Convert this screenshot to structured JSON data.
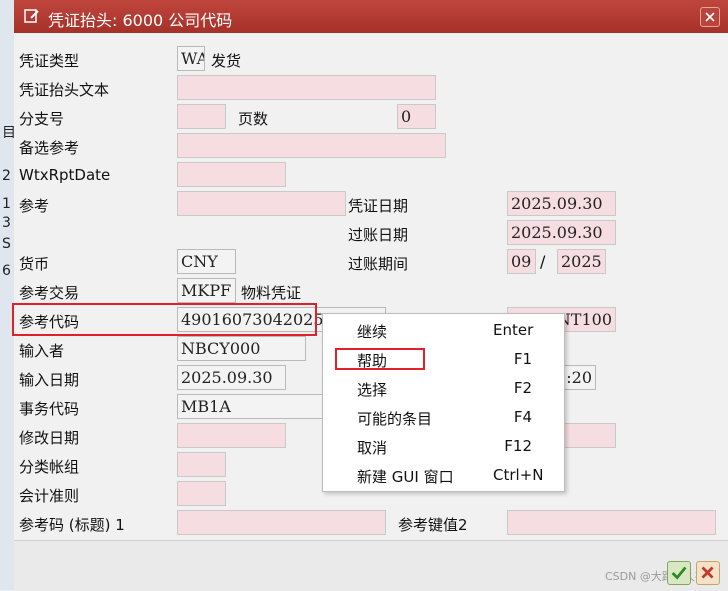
{
  "title": "凭证抬头: 6000 公司代码",
  "side_chars": [
    "目",
    "2",
    "1",
    "3",
    "S",
    "6"
  ],
  "fields": {
    "doc_type_label": "凭证类型",
    "doc_type_value": "WA",
    "doc_type_desc": "发货",
    "header_text_label": "凭证抬头文本",
    "branch_label": "分支号",
    "pages_label": "页数",
    "pages_value": "0",
    "alt_ref_label": "备选参考",
    "wtx_label": "WtxRptDate",
    "ref_label": "参考",
    "doc_date_label": "凭证日期",
    "doc_date_value": "2025.09.30",
    "post_date_label": "过账日期",
    "post_date_value": "2025.09.30",
    "currency_label": "货币",
    "currency_value": "CNY",
    "period_label": "过账期间",
    "period_month": "09",
    "period_sep": "/",
    "period_year": "2025",
    "ref_tx_label": "参考交易",
    "ref_tx_value": "MKPF",
    "ref_tx_desc": "物料凭证",
    "ref_key_label": "参考代码",
    "ref_key_value": "49016073042025",
    "right_partial_1": "NT100",
    "entered_by_label": "输入者",
    "entered_by_value": "NBCY000",
    "entry_date_label": "输入日期",
    "entry_date_value": "2025.09.30",
    "right_partial_2": ":20",
    "tcode_label": "事务代码",
    "tcode_value": "MB1A",
    "change_date_label": "修改日期",
    "ledger_group_label": "分类帐组",
    "acct_principle_label": "会计准则",
    "ref_code_label": "参考码 (标题) 1",
    "ref_key2_label": "参考键值2"
  },
  "menu": [
    {
      "label": "继续",
      "key": "Enter"
    },
    {
      "label": "帮助",
      "key": "F1"
    },
    {
      "label": "选择",
      "key": "F2"
    },
    {
      "label": "可能的条目",
      "key": "F4"
    },
    {
      "label": "取消",
      "key": "F12"
    },
    {
      "label": "新建 GUI 窗口",
      "key": "Ctrl+N"
    }
  ],
  "watermark": "CSDN @大路伦久存在",
  "icons": {
    "title": "edit-document-icon",
    "close": "close-icon",
    "confirm": "check-icon",
    "cancel": "cancel-icon"
  },
  "colors": {
    "titlebar": "#b03a31",
    "required_field": "#f6dde2",
    "highlight": "#e0202a"
  }
}
